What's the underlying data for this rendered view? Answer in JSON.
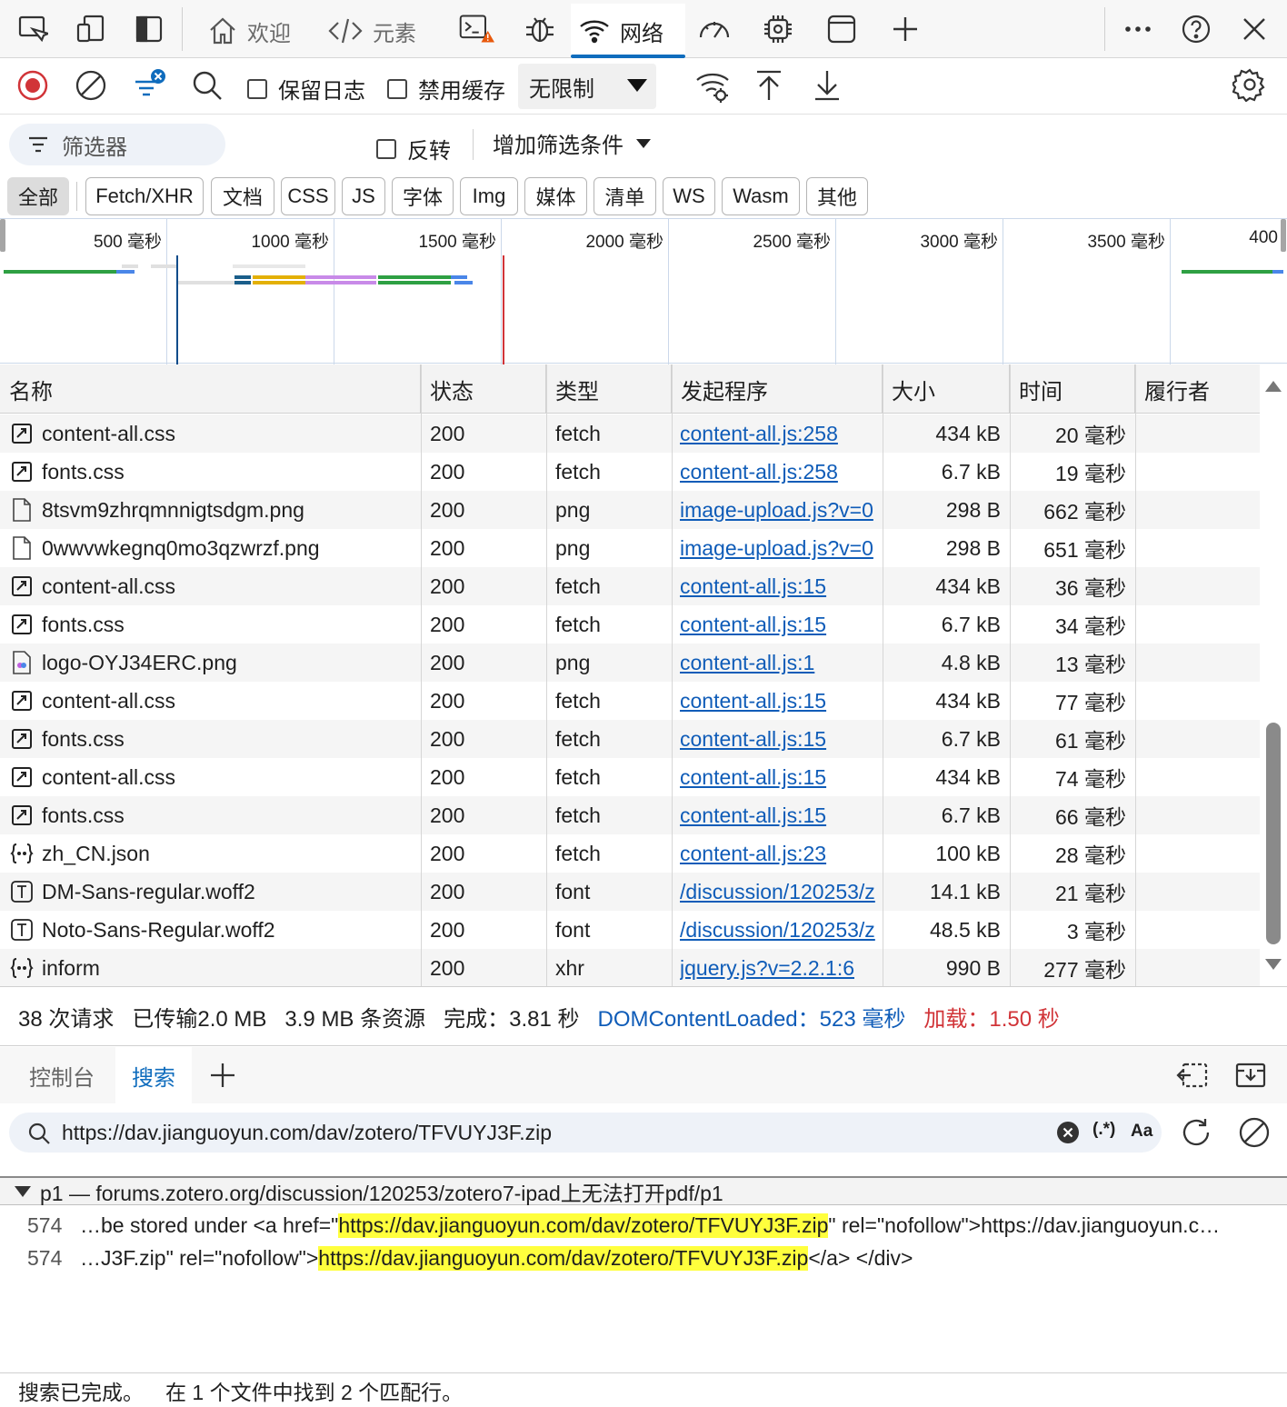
{
  "tabs": {
    "welcome": "欢迎",
    "elements": "元素",
    "network": "网络"
  },
  "toolbar": {
    "preserve_log": "保留日志",
    "disable_cache": "禁用缓存",
    "throttle": "无限制"
  },
  "filter": {
    "placeholder": "筛选器",
    "invert": "反转",
    "more_filters": "增加筛选条件"
  },
  "type_filters": [
    "全部",
    "Fetch/XHR",
    "文档",
    "CSS",
    "JS",
    "字体",
    "Img",
    "媒体",
    "清单",
    "WS",
    "Wasm",
    "其他"
  ],
  "overview": {
    "ticks": [
      "500 毫秒",
      "1000 毫秒",
      "1500 毫秒",
      "2000 毫秒",
      "2500 毫秒",
      "3000 毫秒",
      "3500 毫秒",
      "400"
    ]
  },
  "columns": {
    "name": "名称",
    "status": "状态",
    "type": "类型",
    "initiator": "发起程序",
    "size": "大小",
    "time": "时间",
    "fulfilled_by": "履行者"
  },
  "requests": [
    {
      "icon": "fetch",
      "name": "content-all.css",
      "status": "200",
      "type": "fetch",
      "initiator": "content-all.js:258",
      "size": "434 kB",
      "time": "20 毫秒"
    },
    {
      "icon": "fetch",
      "name": "fonts.css",
      "status": "200",
      "type": "fetch",
      "initiator": "content-all.js:258",
      "size": "6.7 kB",
      "time": "19 毫秒"
    },
    {
      "icon": "doc",
      "name": "8tsvm9zhrqmnnigtsdgm.png",
      "status": "200",
      "type": "png",
      "initiator": "image-upload.js?v=0",
      "size": "298 B",
      "time": "662 毫秒"
    },
    {
      "icon": "doc",
      "name": "0wwvwkegnq0mo3qzwrzf.png",
      "status": "200",
      "type": "png",
      "initiator": "image-upload.js?v=0",
      "size": "298 B",
      "time": "651 毫秒"
    },
    {
      "icon": "fetch",
      "name": "content-all.css",
      "status": "200",
      "type": "fetch",
      "initiator": "content-all.js:15",
      "size": "434 kB",
      "time": "36 毫秒"
    },
    {
      "icon": "fetch",
      "name": "fonts.css",
      "status": "200",
      "type": "fetch",
      "initiator": "content-all.js:15",
      "size": "6.7 kB",
      "time": "34 毫秒"
    },
    {
      "icon": "image",
      "name": "logo-OYJ34ERC.png",
      "status": "200",
      "type": "png",
      "initiator": "content-all.js:1",
      "size": "4.8 kB",
      "time": "13 毫秒"
    },
    {
      "icon": "fetch",
      "name": "content-all.css",
      "status": "200",
      "type": "fetch",
      "initiator": "content-all.js:15",
      "size": "434 kB",
      "time": "77 毫秒"
    },
    {
      "icon": "fetch",
      "name": "fonts.css",
      "status": "200",
      "type": "fetch",
      "initiator": "content-all.js:15",
      "size": "6.7 kB",
      "time": "61 毫秒"
    },
    {
      "icon": "fetch",
      "name": "content-all.css",
      "status": "200",
      "type": "fetch",
      "initiator": "content-all.js:15",
      "size": "434 kB",
      "time": "74 毫秒"
    },
    {
      "icon": "fetch",
      "name": "fonts.css",
      "status": "200",
      "type": "fetch",
      "initiator": "content-all.js:15",
      "size": "6.7 kB",
      "time": "66 毫秒"
    },
    {
      "icon": "json",
      "name": "zh_CN.json",
      "status": "200",
      "type": "fetch",
      "initiator": "content-all.js:23",
      "size": "100 kB",
      "time": "28 毫秒"
    },
    {
      "icon": "font",
      "name": "DM-Sans-regular.woff2",
      "status": "200",
      "type": "font",
      "initiator": "/discussion/120253/z",
      "size": "14.1 kB",
      "time": "21 毫秒"
    },
    {
      "icon": "font",
      "name": "Noto-Sans-Regular.woff2",
      "status": "200",
      "type": "font",
      "initiator": "/discussion/120253/z",
      "size": "48.5 kB",
      "time": "3 毫秒"
    },
    {
      "icon": "json",
      "name": "inform",
      "status": "200",
      "type": "xhr",
      "initiator": "jquery.js?v=2.2.1:6",
      "size": "990 B",
      "time": "277 毫秒"
    }
  ],
  "summary": {
    "requests": "38 次请求",
    "transferred": "已传输2.0 MB",
    "resources": "3.9 MB 条资源",
    "finish": "完成：3.81 秒",
    "domcontentloaded": "DOMContentLoaded：523 毫秒",
    "load": "加载：1.50 秒",
    "dcl_color": "#0f5cb8",
    "load_color": "#d13438"
  },
  "drawer": {
    "console_tab": "控制台",
    "search_tab": "搜索"
  },
  "search": {
    "query": "https://dav.jianguoyun.com/dav/zotero/TFVUYJ3F.zip",
    "regex_label": "(.*)",
    "case_label": "Aa",
    "file_header": "p1 — forums.zotero.org/discussion/120253/zotero7-ipad上无法打开pdf/p1",
    "results": [
      {
        "line": "574",
        "before": "…be stored under <a href=\"",
        "match": "https://dav.jianguoyun.com/dav/zotero/TFVUYJ3F.zip",
        "after": "\" rel=\"nofollow\">https://dav.jianguoyun.c…"
      },
      {
        "line": "574",
        "before": "…J3F.zip\" rel=\"nofollow\">",
        "match": "https://dav.jianguoyun.com/dav/zotero/TFVUYJ3F.zip",
        "after": "</a> </div>"
      }
    ],
    "status_done": "搜索已完成。",
    "status_found": "在 1 个文件中找到 2 个匹配行。"
  }
}
